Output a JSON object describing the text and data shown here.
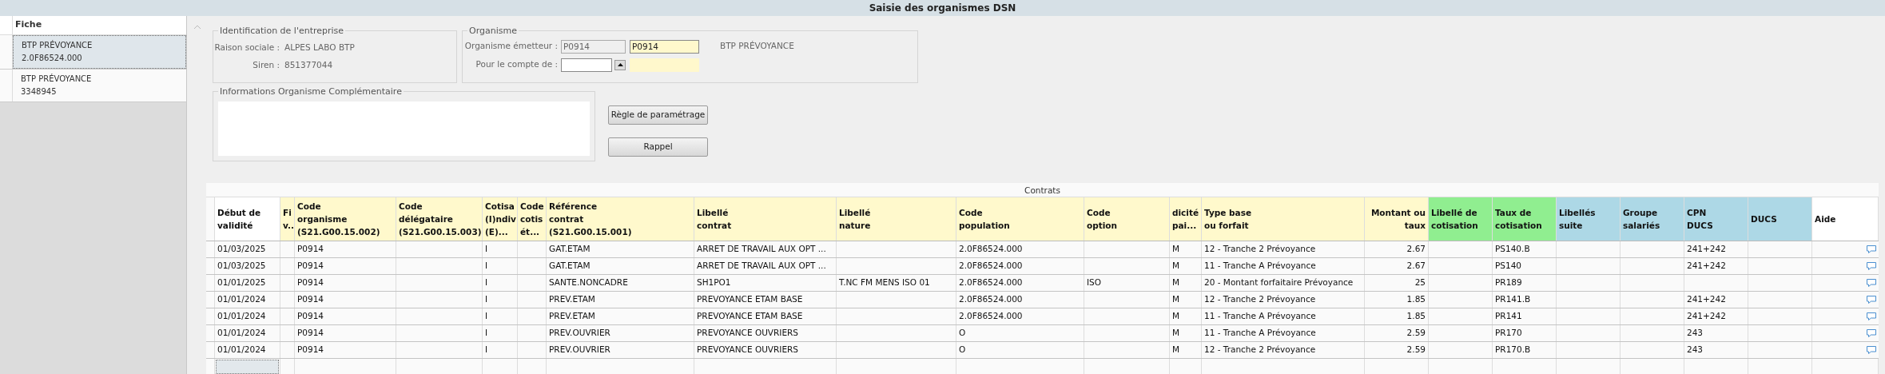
{
  "window": {
    "title": "Saisie des organismes DSN"
  },
  "sidebar": {
    "header": "Fiche",
    "items": [
      {
        "line1": "BTP PRÉVOYANCE",
        "line2": "2.0F86524.000",
        "selected": true
      },
      {
        "line1": "BTP PRÉVOYANCE",
        "line2": "3348945",
        "selected": false
      }
    ]
  },
  "identification": {
    "title": "Identification de l'entreprise",
    "fields": [
      {
        "label": "Raison sociale :",
        "value": "ALPES LABO BTP"
      },
      {
        "label": "Siren :",
        "value": "851377044"
      }
    ]
  },
  "organisme": {
    "title": "Organisme",
    "emetteur_label": "Organisme émetteur :",
    "emetteur_code": "P0914",
    "emetteur_value": "P0914",
    "emetteur_name": "BTP PRÉVOYANCE",
    "compte_label": "Pour le compte de :"
  },
  "informations": {
    "title": "Informations Organisme Complémentaire"
  },
  "buttons": [
    "Règle de paramétrage",
    "Rappel"
  ],
  "table": {
    "title": "Contrats",
    "columns": [
      {
        "label": "Début de\nvalidité",
        "color": "#ffffff"
      },
      {
        "label": "Fi\nv..",
        "color": "#fff9cc"
      },
      {
        "label": "Code\norganisme\n(S21.G00.15.002)",
        "color": "#fff9cc"
      },
      {
        "label": "Code\ndélégataire\n(S21.G00.15.003)",
        "color": "#fff9cc"
      },
      {
        "label": "Cotisa\n(I)ndiv\n(E)...",
        "color": "#fff9cc"
      },
      {
        "label": "Code\ncotis\nét...",
        "color": "#fff9cc"
      },
      {
        "label": "Référence\ncontrat\n(S21.G00.15.001)",
        "color": "#fff9cc"
      },
      {
        "label": "Libellé\ncontrat",
        "color": "#fff9cc"
      },
      {
        "label": "Libellé\nnature",
        "color": "#fff9cc"
      },
      {
        "label": "Code\npopulation",
        "color": "#fff9cc"
      },
      {
        "label": "Code\noption",
        "color": "#fff9cc"
      },
      {
        "label": "dicité\npai...",
        "color": "#fff9cc"
      },
      {
        "label": "Type base\n ou forfait",
        "color": "#fff9cc"
      },
      {
        "label": "Montant ou\ntaux",
        "color": "#fff9cc"
      },
      {
        "label": "Libellé de\ncotisation",
        "color": "#90ee90"
      },
      {
        "label": "Taux de\ncotisation",
        "color": "#90ee90"
      },
      {
        "label": "Libellés\nsuite",
        "color": "#add8e6"
      },
      {
        "label": "Groupe\nsalariés",
        "color": "#add8e6"
      },
      {
        "label": "CPN\nDUCS",
        "color": "#add8e6"
      },
      {
        "label": "DUCS",
        "color": "#add8e6"
      },
      {
        "label": "Aide",
        "color": "#ffffff"
      }
    ],
    "rows": [
      [
        "01/03/2025",
        null,
        "P0914",
        null,
        "I",
        null,
        "GAT.ETAM",
        "ARRET DE TRAVAIL AUX OPT ...",
        null,
        "2.0F86524.000",
        null,
        "M",
        "12 - Tranche 2 Prévoyance",
        "2.67",
        null,
        "PS140.B",
        null,
        null,
        "241+242",
        null
      ],
      [
        "01/03/2025",
        null,
        "P0914",
        null,
        "I",
        null,
        "GAT.ETAM",
        "ARRET DE TRAVAIL AUX OPT ...",
        null,
        "2.0F86524.000",
        null,
        "M",
        "11 - Tranche A Prévoyance",
        "2.67",
        null,
        "PS140",
        null,
        null,
        "241+242",
        null
      ],
      [
        "01/01/2025",
        null,
        "P0914",
        null,
        "I",
        null,
        "SANTE.NONCADRE",
        "SH1PO1",
        "T.NC FM MENS ISO  01",
        "2.0F86524.000",
        "ISO",
        "M",
        "20 - Montant forfaitaire Prévoyance",
        "25",
        null,
        "PR189",
        null,
        null,
        null,
        null
      ],
      [
        "01/01/2024",
        null,
        "P0914",
        null,
        "I",
        null,
        "PREV.ETAM",
        "PREVOYANCE ETAM BASE",
        null,
        "2.0F86524.000",
        null,
        "M",
        "12 - Tranche 2 Prévoyance",
        "1.85",
        null,
        "PR141.B",
        null,
        null,
        "241+242",
        null
      ],
      [
        "01/01/2024",
        null,
        "P0914",
        null,
        "I",
        null,
        "PREV.ETAM",
        "PREVOYANCE ETAM BASE",
        null,
        "2.0F86524.000",
        null,
        "M",
        "11 - Tranche A Prévoyance",
        "1.85",
        null,
        "PR141",
        null,
        null,
        "241+242",
        null
      ],
      [
        "01/01/2024",
        null,
        "P0914",
        null,
        "I",
        null,
        "PREV.OUVRIER",
        "PREVOYANCE OUVRIERS",
        null,
        "O",
        null,
        "M",
        "11 - Tranche A Prévoyance",
        "2.59",
        null,
        "PR170",
        null,
        null,
        "243",
        null
      ],
      [
        "01/01/2024",
        null,
        "P0914",
        null,
        "I",
        null,
        "PREV.OUVRIER",
        "PREVOYANCE OUVRIERS",
        null,
        "O",
        null,
        "M",
        "12 - Tranche 2 Prévoyance",
        "2.59",
        null,
        "PR170.B",
        null,
        null,
        "243",
        null
      ]
    ]
  }
}
